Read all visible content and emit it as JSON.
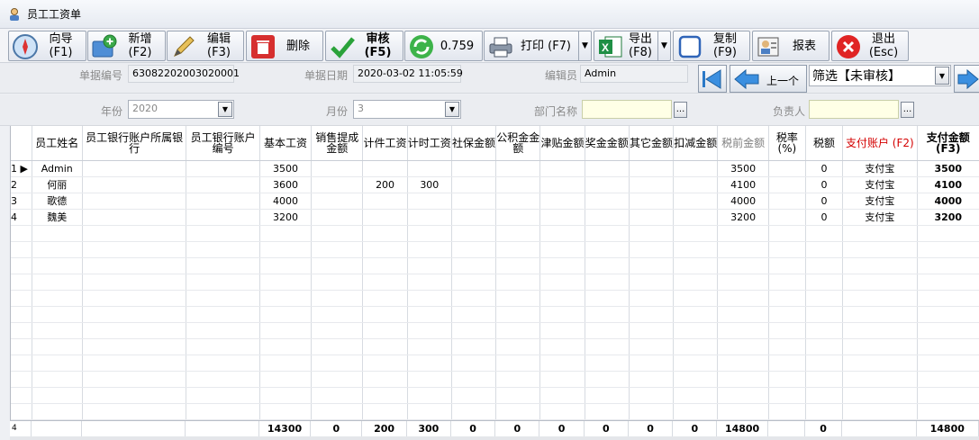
{
  "window": {
    "title": "员工工资单"
  },
  "toolbar": {
    "wizard": {
      "line1": "向导",
      "line2": "(F1)",
      "icon": "compass-icon"
    },
    "add": {
      "line1": "新增",
      "line2": "(F2)",
      "icon": "add-folder-icon"
    },
    "edit": {
      "line1": "编辑",
      "line2": "(F3)",
      "icon": "pencil-icon"
    },
    "delete": {
      "line1": "删除",
      "icon": "trash-icon"
    },
    "audit": {
      "line1": "审核",
      "line2": "(F5)",
      "icon": "checkmark-icon"
    },
    "refresh": {
      "line1": "0.759",
      "icon": "refresh-icon"
    },
    "print": {
      "line1": "打印 (F7)",
      "icon": "printer-icon"
    },
    "export": {
      "line1": "导出",
      "line2": "(F8)",
      "icon": "excel-icon"
    },
    "copy": {
      "line1": "复制",
      "line2": "(F9)",
      "icon": "copy-icon"
    },
    "report": {
      "line1": "报表",
      "icon": "report-icon"
    },
    "exit": {
      "line1": "退出",
      "line2": "(Esc)",
      "icon": "close-icon"
    }
  },
  "header": {
    "doc_no_label": "单据编号",
    "doc_no": "63082202003020001",
    "doc_date_label": "单据日期",
    "doc_date": "2020-03-02 11:05:59",
    "editor_label": "编辑员",
    "editor": "Admin",
    "prev_label": "上一个",
    "filter_value": "筛选【未审核】",
    "year_label": "年份",
    "year": "2020",
    "month_label": "月份",
    "month": "3",
    "dept_label": "部门名称",
    "dept": "",
    "owner_label": "负责人",
    "owner": ""
  },
  "grid": {
    "columns": [
      "员工姓名",
      "员工银行账户所属银行",
      "员工银行账户编号",
      "基本工资",
      "销售提成金额",
      "计件工资",
      "计时工资",
      "社保金额",
      "公积金金额",
      "津贴金额",
      "奖金金额",
      "其它金额",
      "扣减金额",
      "税前金额",
      "税率(%)",
      "税额",
      "支付账户 (F2)",
      "支付金额(F3)"
    ],
    "rows": [
      {
        "no": "1",
        "name": "Admin",
        "bank": "",
        "account": "",
        "base": "3500",
        "sales": "",
        "piece": "",
        "hourly": "",
        "social": "",
        "fund": "",
        "allowance": "",
        "bonus": "",
        "other": "",
        "deduct": "",
        "pretax": "3500",
        "rate": "",
        "tax": "0",
        "payacct": "支付宝",
        "pay": "3500"
      },
      {
        "no": "2",
        "name": "何丽",
        "bank": "",
        "account": "",
        "base": "3600",
        "sales": "",
        "piece": "200",
        "hourly": "300",
        "social": "",
        "fund": "",
        "allowance": "",
        "bonus": "",
        "other": "",
        "deduct": "",
        "pretax": "4100",
        "rate": "",
        "tax": "0",
        "payacct": "支付宝",
        "pay": "4100"
      },
      {
        "no": "3",
        "name": "歌德",
        "bank": "",
        "account": "",
        "base": "4000",
        "sales": "",
        "piece": "",
        "hourly": "",
        "social": "",
        "fund": "",
        "allowance": "",
        "bonus": "",
        "other": "",
        "deduct": "",
        "pretax": "4000",
        "rate": "",
        "tax": "0",
        "payacct": "支付宝",
        "pay": "4000"
      },
      {
        "no": "4",
        "name": "魏美",
        "bank": "",
        "account": "",
        "base": "3200",
        "sales": "",
        "piece": "",
        "hourly": "",
        "social": "",
        "fund": "",
        "allowance": "",
        "bonus": "",
        "other": "",
        "deduct": "",
        "pretax": "3200",
        "rate": "",
        "tax": "0",
        "payacct": "支付宝",
        "pay": "3200"
      }
    ],
    "totals": {
      "count": "4",
      "base": "14300",
      "sales": "0",
      "piece": "200",
      "hourly": "300",
      "social": "0",
      "fund": "0",
      "allowance": "0",
      "bonus": "0",
      "other": "0",
      "deduct": "0",
      "pretax": "14800",
      "tax": "0",
      "pay": "14800"
    }
  },
  "colors": {
    "payacct_header": "#d40000",
    "pretax_header": "#7f7f7f"
  }
}
